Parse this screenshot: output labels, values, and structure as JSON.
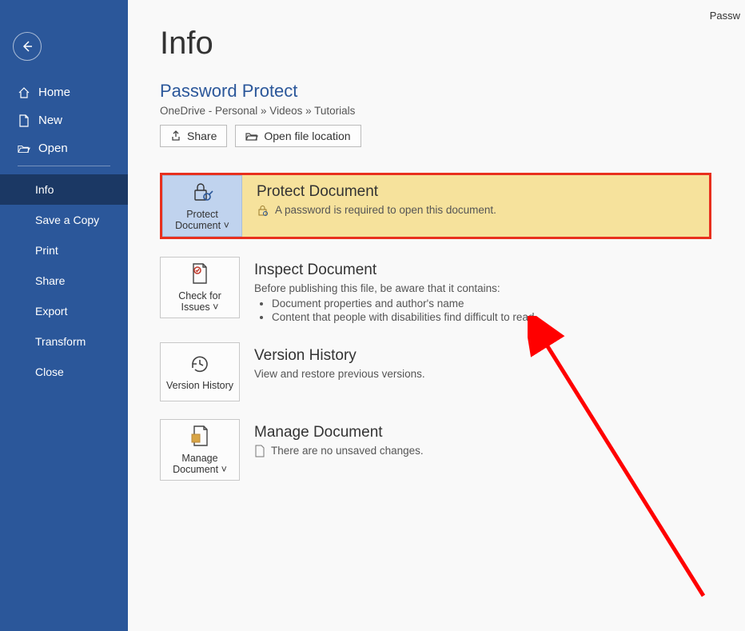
{
  "top_right": "Passw",
  "sidebar": {
    "top": [
      {
        "label": "Home"
      },
      {
        "label": "New"
      },
      {
        "label": "Open"
      }
    ],
    "sub": [
      {
        "label": "Info",
        "selected": true
      },
      {
        "label": "Save a Copy"
      },
      {
        "label": "Print"
      },
      {
        "label": "Share"
      },
      {
        "label": "Export"
      },
      {
        "label": "Transform"
      },
      {
        "label": "Close"
      }
    ]
  },
  "page": {
    "title": "Info",
    "doc_name": "Password Protect",
    "breadcrumb": "OneDrive - Personal » Videos » Tutorials",
    "share_label": "Share",
    "open_loc_label": "Open file location"
  },
  "protect": {
    "btn_label": "Protect Document",
    "title": "Protect Document",
    "desc": "A password is required to open this document."
  },
  "inspect": {
    "btn_label": "Check for Issues",
    "title": "Inspect Document",
    "desc_intro": "Before publishing this file, be aware that it contains:",
    "items": [
      "Document properties and author's name",
      "Content that people with disabilities find difficult to read"
    ]
  },
  "version": {
    "btn_label": "Version History",
    "title": "Version History",
    "desc": "View and restore previous versions."
  },
  "manage": {
    "btn_label": "Manage Document",
    "title": "Manage Document",
    "desc": "There are no unsaved changes."
  }
}
